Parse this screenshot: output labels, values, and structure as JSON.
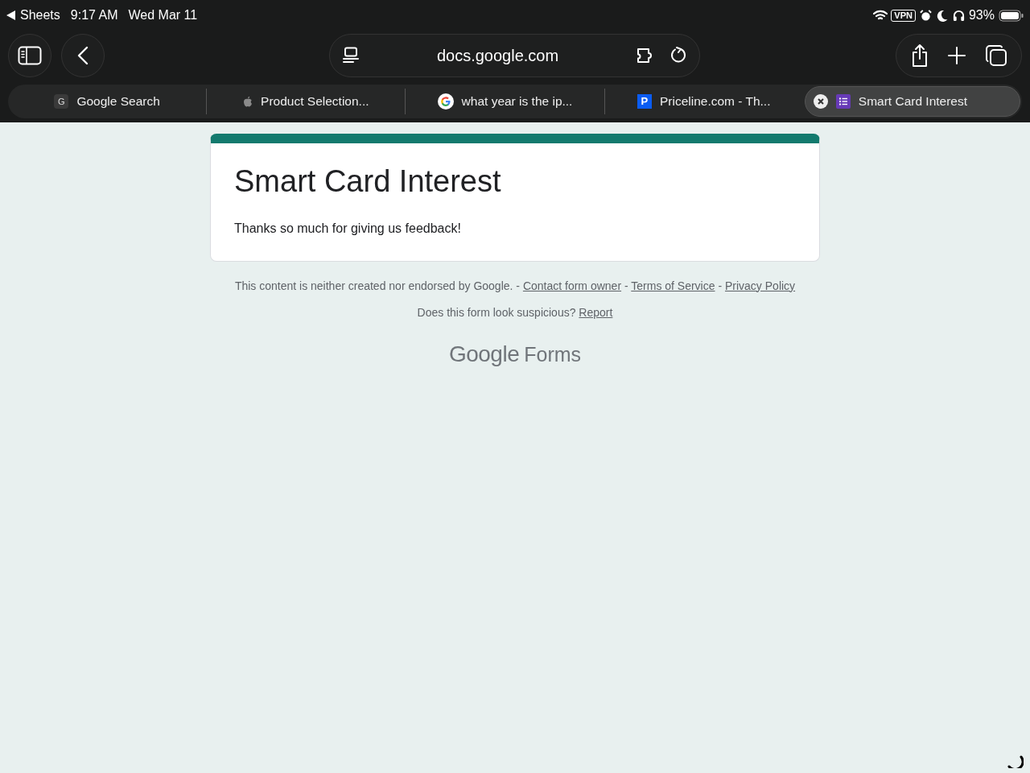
{
  "status_bar": {
    "back_app": "Sheets",
    "time": "9:17 AM",
    "date": "Wed Mar 11",
    "vpn": "VPN",
    "battery": "93%"
  },
  "toolbar": {
    "address": "docs.google.com"
  },
  "tabs": [
    {
      "title": "Google Search",
      "favicon": {
        "kind": "letter",
        "letter": "G"
      },
      "selected": false
    },
    {
      "title": "Product Selection...",
      "favicon": {
        "kind": "apple"
      },
      "selected": false
    },
    {
      "title": "what year is the ip...",
      "favicon": {
        "kind": "google"
      },
      "selected": false
    },
    {
      "title": "Priceline.com - Th...",
      "favicon": {
        "kind": "badge",
        "letter": "P"
      },
      "selected": false
    },
    {
      "title": "Smart Card Interest",
      "favicon": {
        "kind": "forms"
      },
      "selected": true
    }
  ],
  "form": {
    "title": "Smart Card Interest",
    "message": "Thanks so much for giving us feedback!"
  },
  "footer": {
    "disclaimer": "This content is neither created nor endorsed by Google.",
    "separator": "-",
    "links": [
      "Contact form owner",
      "Terms of Service",
      "Privacy Policy"
    ],
    "question": "Does this form look suspicious?",
    "report": "Report",
    "logo_brand": "Google",
    "logo_product": "Forms"
  }
}
